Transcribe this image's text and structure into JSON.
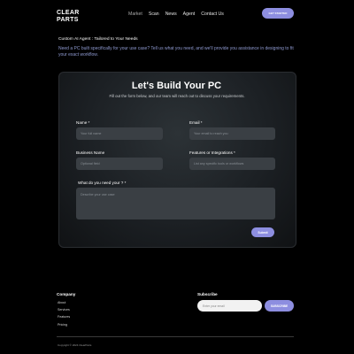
{
  "header": {
    "logo_line1": "CLEAR",
    "logo_line2": "PARTS",
    "nav": [
      "Market",
      "Scan",
      "News",
      "Agent",
      "Contact Us"
    ],
    "cta": "GET STARTED"
  },
  "intro": {
    "tag": "Custom AI Agent : Tailored to Your Needs",
    "lead": "Need a PC built specifically for your use case? Tell us what you need, and we'll provide you assistance in designing to fit your exact workflow."
  },
  "form": {
    "title": "Let's Build Your PC",
    "subtitle": "Fill out the form below, and our team will reach out to discuss your requirements.",
    "name_label": "Name *",
    "name_placeholder": "Your full name",
    "email_label": "Email *",
    "email_placeholder": "Your email to reach you",
    "business_label": "Business Name",
    "business_placeholder": "Optional field",
    "features_label": "Features or Integrations *",
    "features_placeholder": "List any specific tools or workflows",
    "need_label": "What do you need your ? *",
    "need_placeholder": "Describe your use case",
    "submit": "Submit"
  },
  "footer": {
    "company_heading": "Company",
    "links": [
      "About",
      "Services",
      "Features",
      "Pricing"
    ],
    "subscribe_heading": "Subscribe",
    "subscribe_placeholder": "Enter your email",
    "subscribe_button": "SUBSCRIBE",
    "copyright": "Copyright © 2024 ClearParts"
  },
  "colors": {
    "accent": "#8d8ee0",
    "background": "#000000",
    "field": "#3a3f44"
  }
}
